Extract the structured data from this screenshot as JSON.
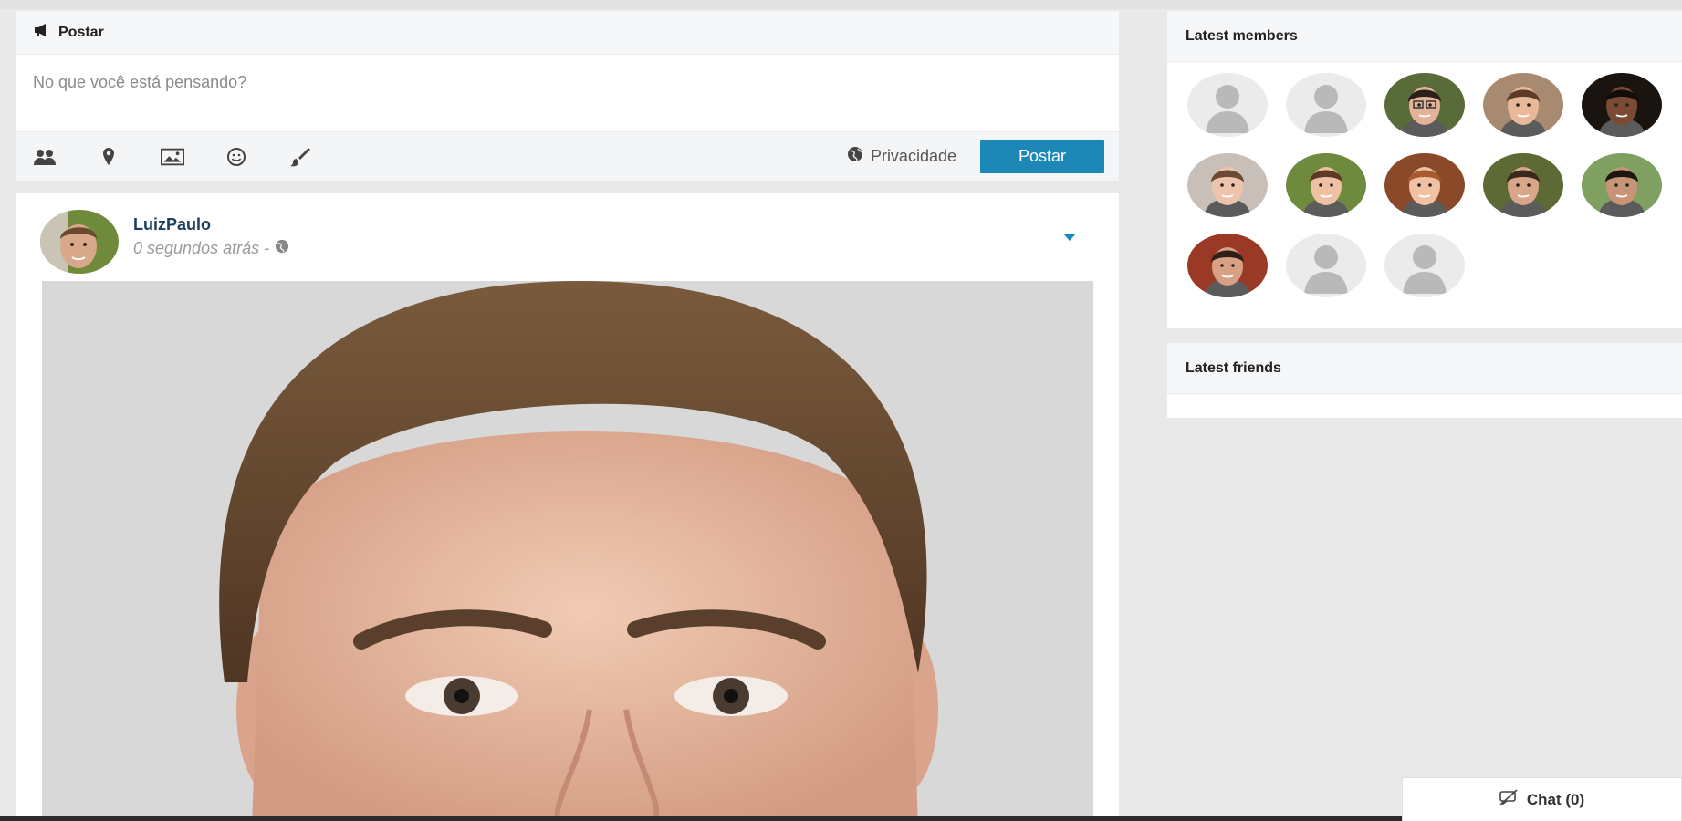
{
  "composer": {
    "title": "Postar",
    "placeholder": "No que você está pensando?",
    "privacy_label": "Privacidade",
    "post_button": "Postar",
    "tools": [
      "friends-icon",
      "location-pin-icon",
      "photo-icon",
      "emoji-icon",
      "brush-icon"
    ]
  },
  "post": {
    "author": "LuizPaulo",
    "time": "0 segundos atrás -",
    "privacy_icon": "globe-icon"
  },
  "sidebar": {
    "latest_members_title": "Latest members",
    "latest_friends_title": "Latest friends",
    "member_avatars": [
      "default-avatar",
      "default-avatar",
      "woman-glasses-avatar",
      "man-smiling-avatar",
      "woman-dark-hair-avatar",
      "woman-brown-hair-avatar",
      "woman-smiling-avatar",
      "woman-red-hair-avatar",
      "man-beard-avatar",
      "man-dark-hair-avatar",
      "man-red-background-avatar",
      "default-avatar",
      "default-avatar"
    ]
  },
  "chat": {
    "label": "Chat (0)"
  },
  "colors": {
    "accent": "#1d88b6",
    "author_link": "#1a3e5c",
    "page_bg": "#e9e9e9"
  }
}
